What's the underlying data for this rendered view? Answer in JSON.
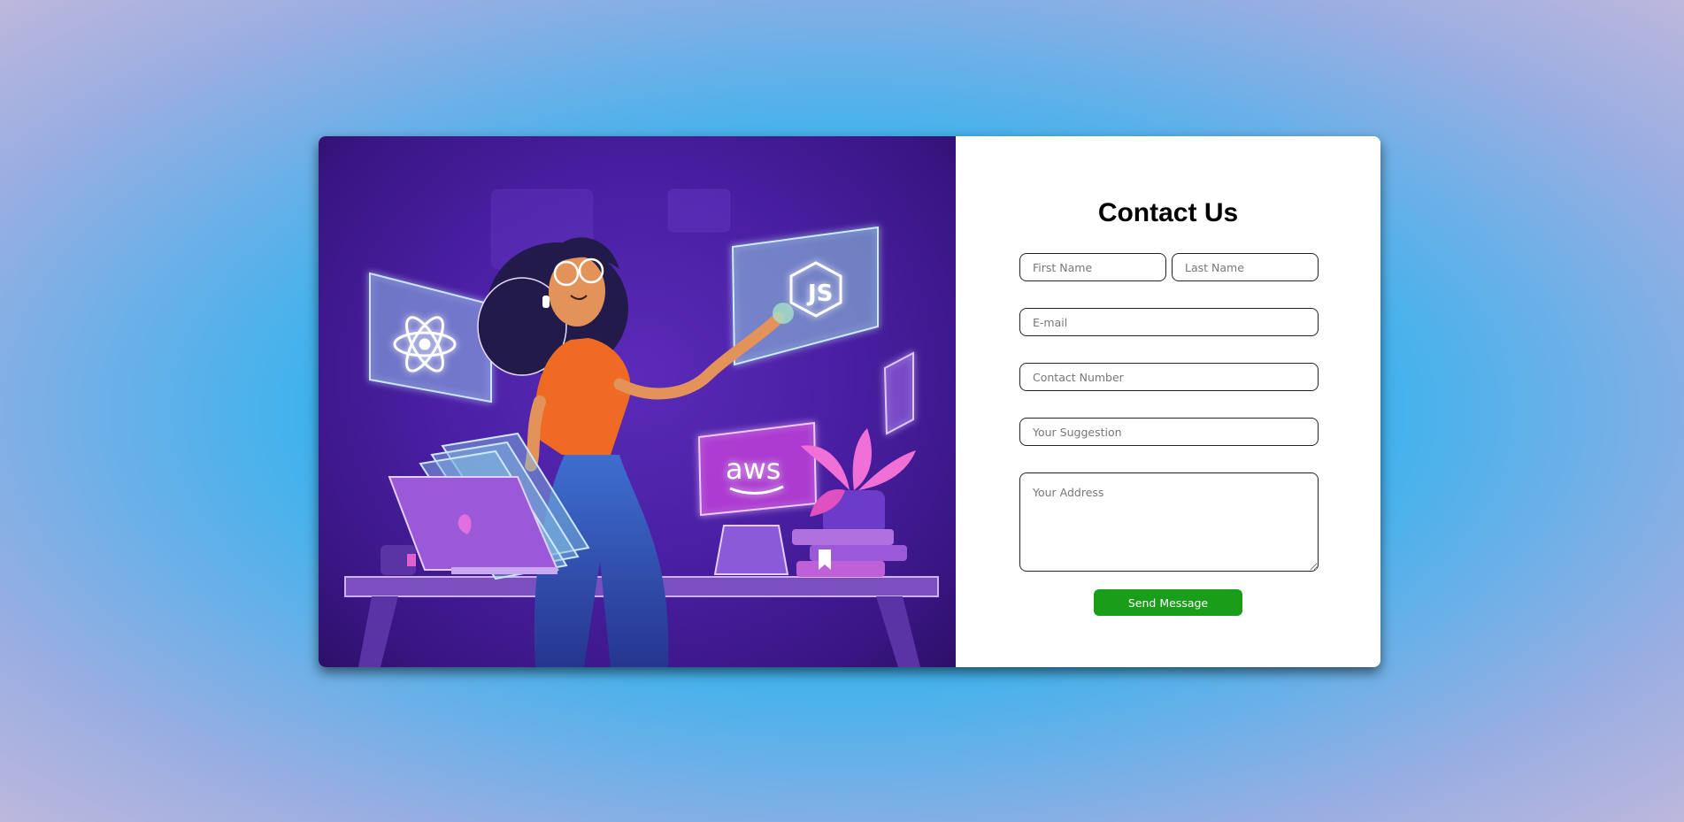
{
  "form": {
    "title": "Contact Us",
    "first_name_placeholder": "First Name",
    "last_name_placeholder": "Last Name",
    "email_placeholder": "E-mail",
    "contact_placeholder": "Contact Number",
    "suggestion_placeholder": "Your Suggestion",
    "address_placeholder": "Your Address",
    "submit_label": "Send Message"
  },
  "illustration": {
    "aws_label": "aws",
    "node_label": "JS",
    "icons": [
      "react-icon",
      "nodejs-icon",
      "aws-icon",
      "laptop-icon",
      "plant-icon",
      "books-icon"
    ]
  },
  "colors": {
    "submit_bg": "#1a9e1a",
    "illustration_bg": "#4a1fa3",
    "page_bg": "#27b3ee"
  }
}
